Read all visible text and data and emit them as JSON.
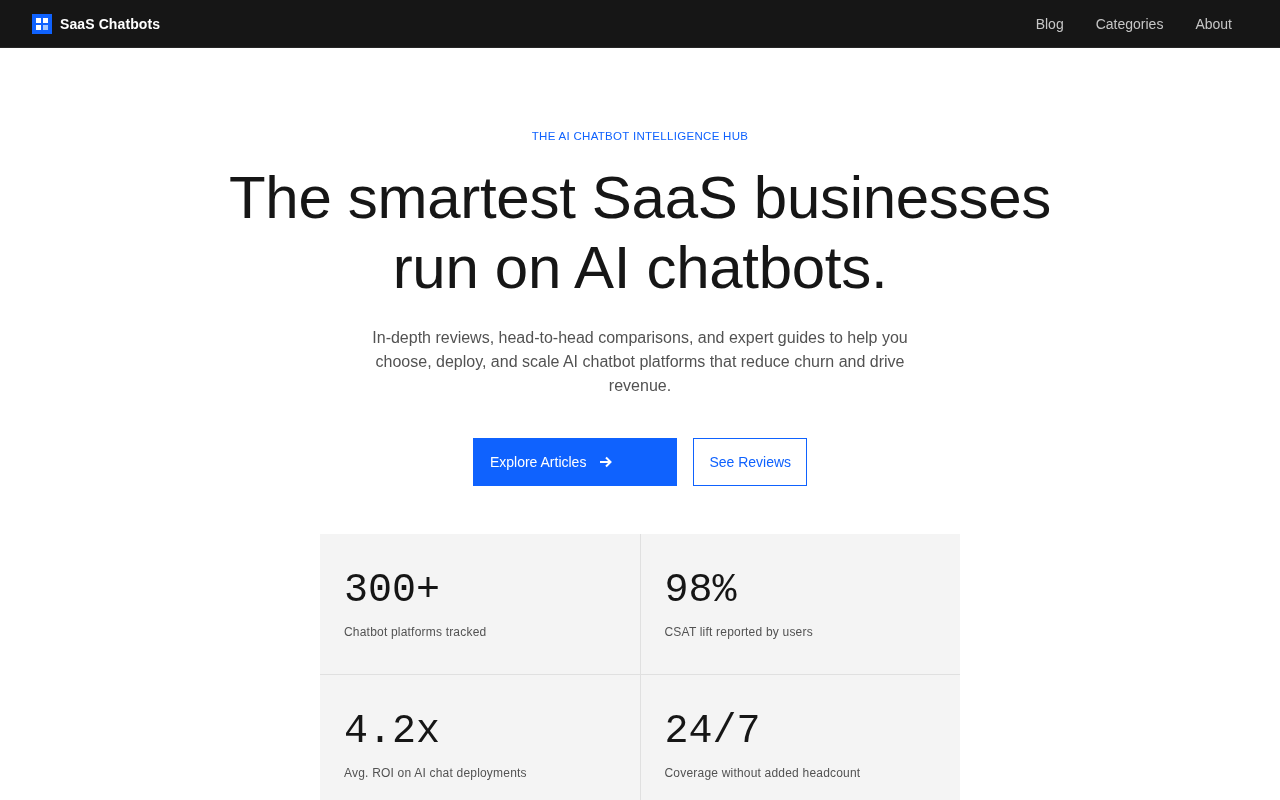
{
  "nav": {
    "brand": "SaaS Chatbots",
    "links": [
      {
        "label": "Blog"
      },
      {
        "label": "Categories"
      },
      {
        "label": "About"
      }
    ]
  },
  "hero": {
    "eyebrow": "THE AI CHATBOT INTELLIGENCE HUB",
    "headline": "The smartest SaaS businesses run on AI chatbots.",
    "subtitle": "In-depth reviews, head-to-head comparisons, and expert guides to help you choose, deploy, and scale AI chatbot platforms that reduce churn and drive revenue.",
    "buttons": [
      {
        "label": "Explore Articles",
        "kind": "primary"
      },
      {
        "label": "See Reviews",
        "kind": "secondary"
      }
    ]
  },
  "stats": [
    {
      "value": "300+",
      "label": "Chatbot platforms tracked"
    },
    {
      "value": "98%",
      "label": "CSAT lift reported by users"
    },
    {
      "value": "4.2x",
      "label": "Avg. ROI on AI chat deployments"
    },
    {
      "value": "24/7",
      "label": "Coverage without added headcount"
    }
  ]
}
